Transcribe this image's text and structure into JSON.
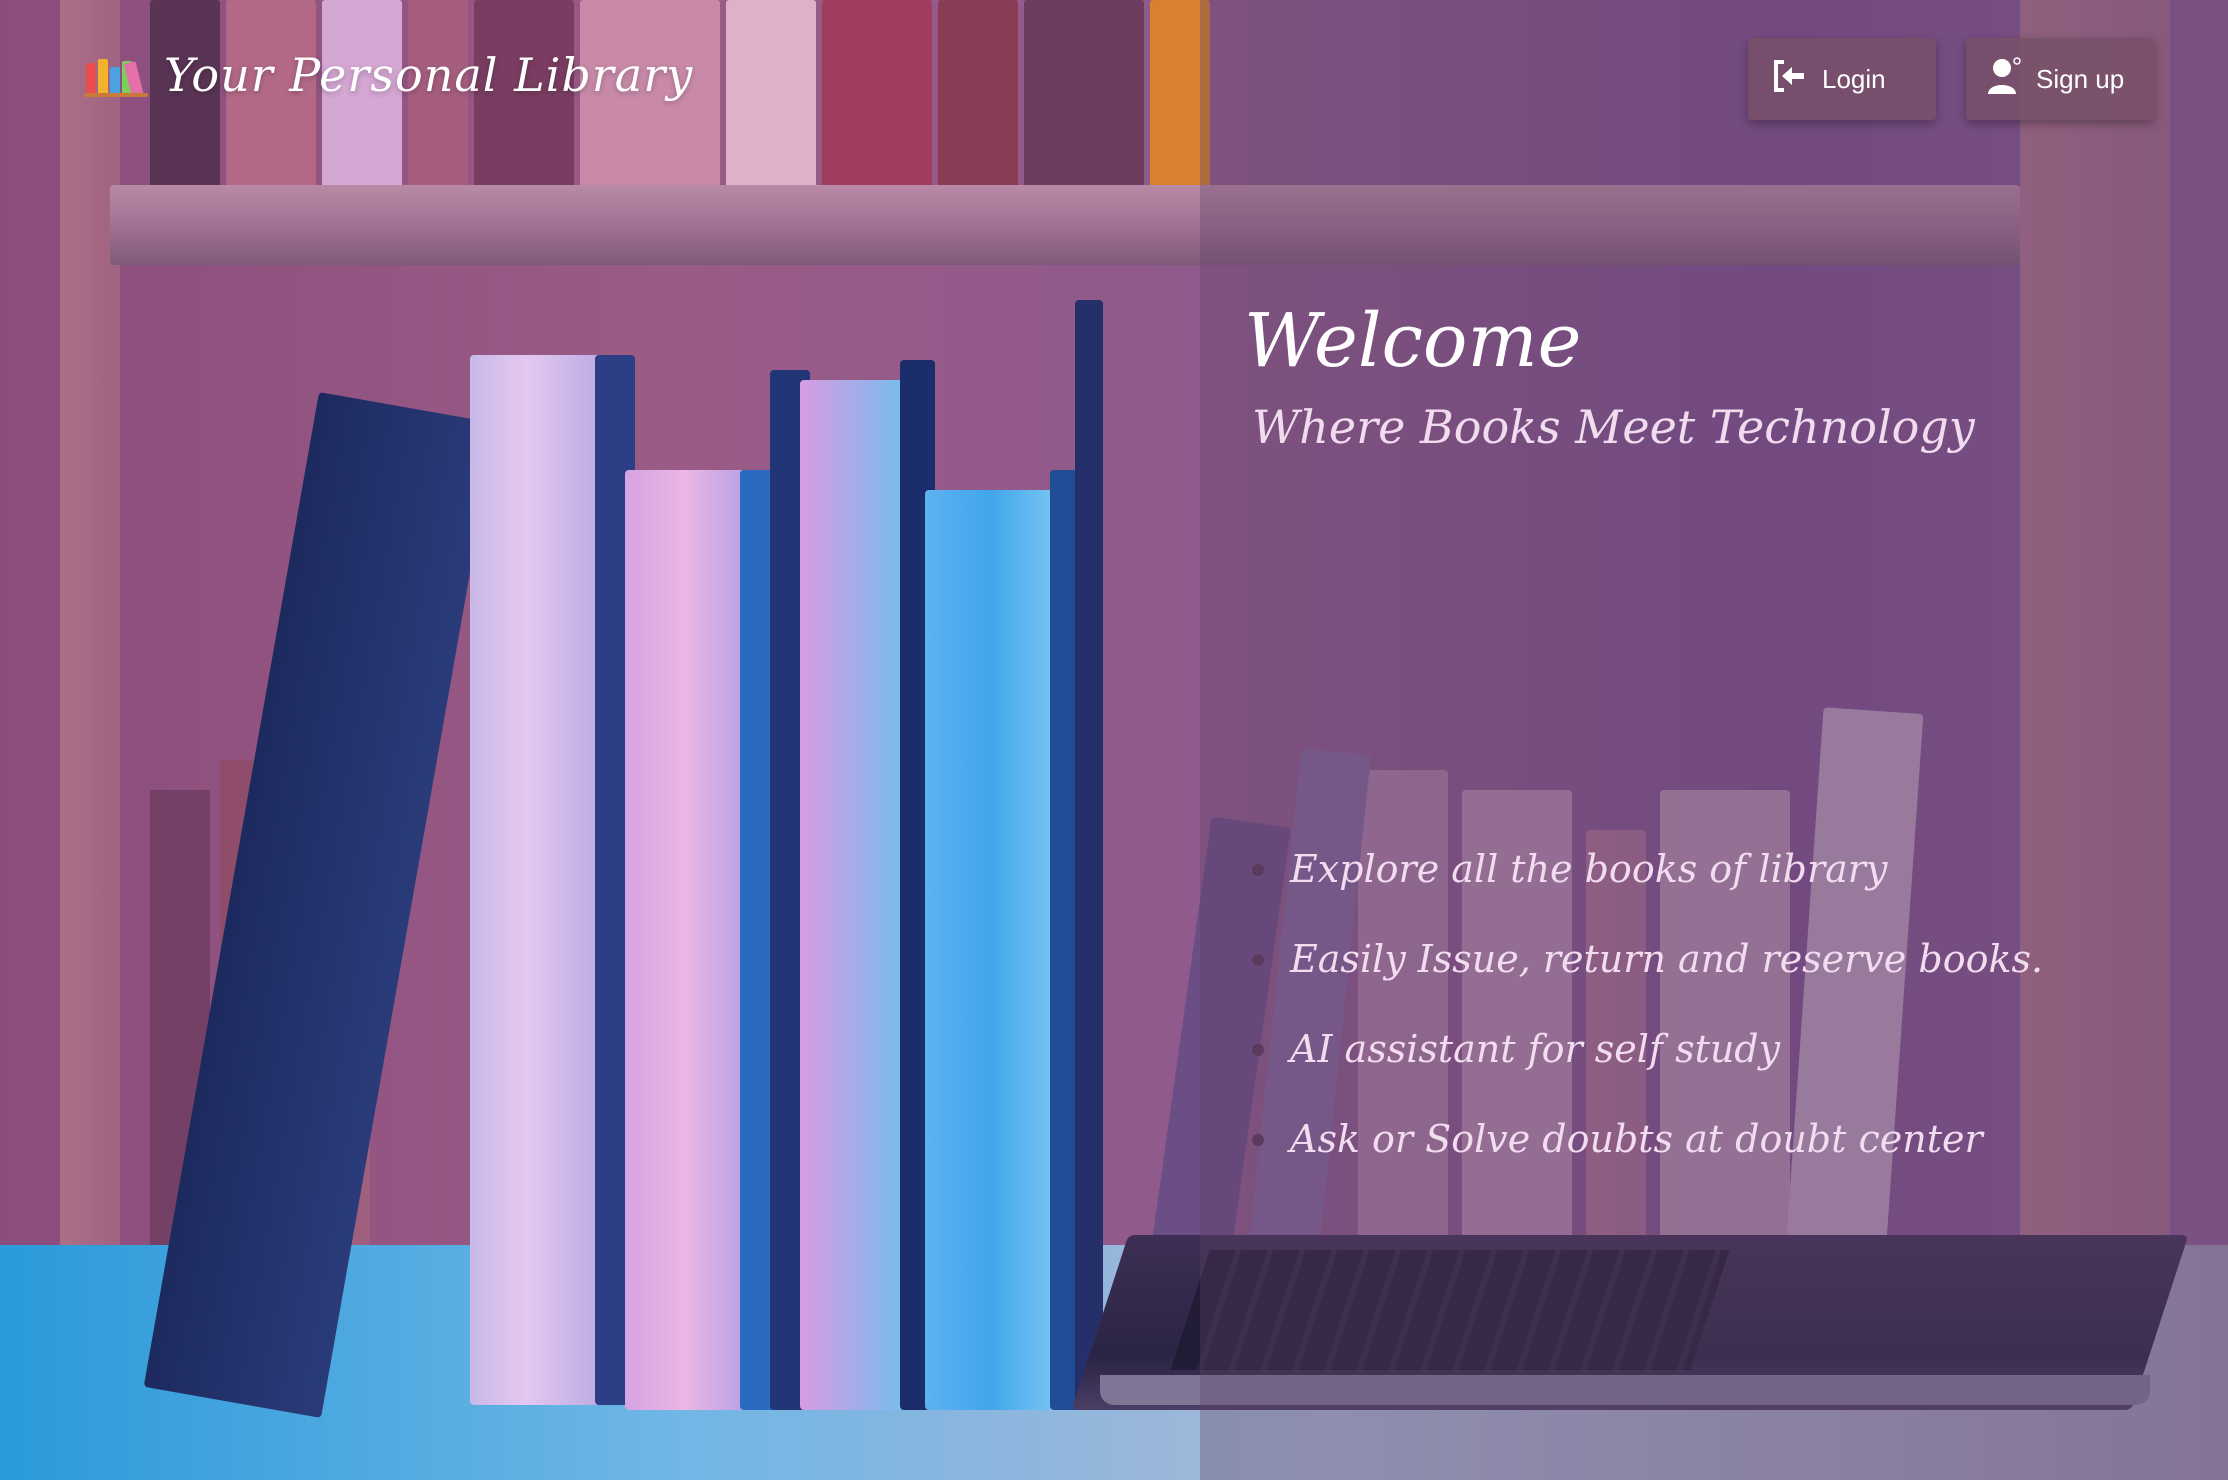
{
  "navbar": {
    "brand_title": "Your Personal Library",
    "login_label": "Login",
    "signup_label": "Sign up",
    "login_icon": "login-arrow-icon",
    "signup_icon": "user-icon"
  },
  "hero": {
    "title": "Welcome",
    "subtitle": "Where Books Meet Technology"
  },
  "features": [
    "Explore all the books of library",
    "Easily Issue, return and reserve books.",
    "AI assistant for self study",
    "Ask or Solve doubts at doubt center"
  ],
  "colors": {
    "button_bg": "#784f69",
    "text_light": "#f2dcef",
    "overlay": "#5f4164"
  }
}
